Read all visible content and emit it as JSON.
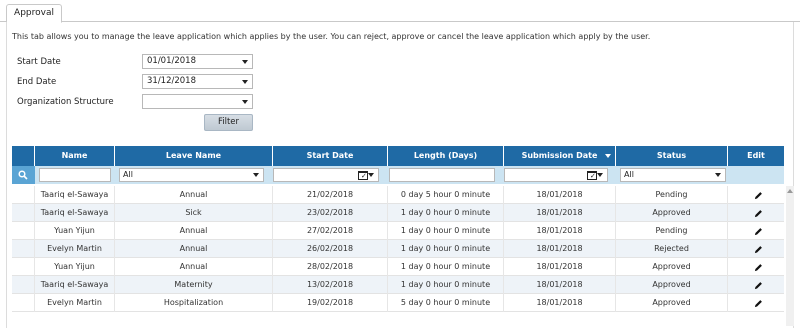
{
  "tab": {
    "label": "Approval"
  },
  "description": "This tab allows you to manage the leave application which applies by the user. You can reject, approve or cancel the leave application which apply by the user.",
  "form": {
    "start_date_label": "Start Date",
    "start_date_value": "01/01/2018",
    "end_date_label": "End Date",
    "end_date_value": "31/12/2018",
    "org_label": "Organization Structure",
    "org_value": "",
    "filter_label": "Filter"
  },
  "table": {
    "columns": [
      "Name",
      "Leave Name",
      "Start Date",
      "Length (Days)",
      "Submission Date",
      "Status",
      "Edit"
    ],
    "filters": {
      "leave_name": "All",
      "status": "All",
      "name": "",
      "length": ""
    },
    "rows": [
      {
        "name": "Taariq el-Sawaya",
        "leave": "Annual",
        "start": "21/02/2018",
        "length": "0 day 5 hour 0 minute",
        "submission": "18/01/2018",
        "status": "Pending"
      },
      {
        "name": "Taariq el-Sawaya",
        "leave": "Sick",
        "start": "23/02/2018",
        "length": "1 day 0 hour 0 minute",
        "submission": "18/01/2018",
        "status": "Approved"
      },
      {
        "name": "Yuan Yijun",
        "leave": "Annual",
        "start": "27/02/2018",
        "length": "1 day 0 hour 0 minute",
        "submission": "18/01/2018",
        "status": "Pending"
      },
      {
        "name": "Evelyn Martin",
        "leave": "Annual",
        "start": "26/02/2018",
        "length": "1 day 0 hour 0 minute",
        "submission": "18/01/2018",
        "status": "Rejected"
      },
      {
        "name": "Yuan Yijun",
        "leave": "Annual",
        "start": "28/02/2018",
        "length": "1 day 0 hour 0 minute",
        "submission": "18/01/2018",
        "status": "Approved"
      },
      {
        "name": "Taariq el-Sawaya",
        "leave": "Maternity",
        "start": "13/02/2018",
        "length": "1 day 0 hour 0 minute",
        "submission": "18/01/2018",
        "status": "Approved"
      },
      {
        "name": "Evelyn Martin",
        "leave": "Hospitalization",
        "start": "19/02/2018",
        "length": "5 day 0 hour 0 minute",
        "submission": "18/01/2018",
        "status": "Approved"
      }
    ]
  },
  "icons": {
    "search": "search-icon",
    "calendar": "calendar-icon",
    "edit": "pencil-icon",
    "dropdown": "chevron-down-icon"
  },
  "colors": {
    "header": "#1f6aa5",
    "filter_row": "#cce4f2",
    "search_cell": "#5aa4d4",
    "alt_row": "#eef3f8"
  }
}
